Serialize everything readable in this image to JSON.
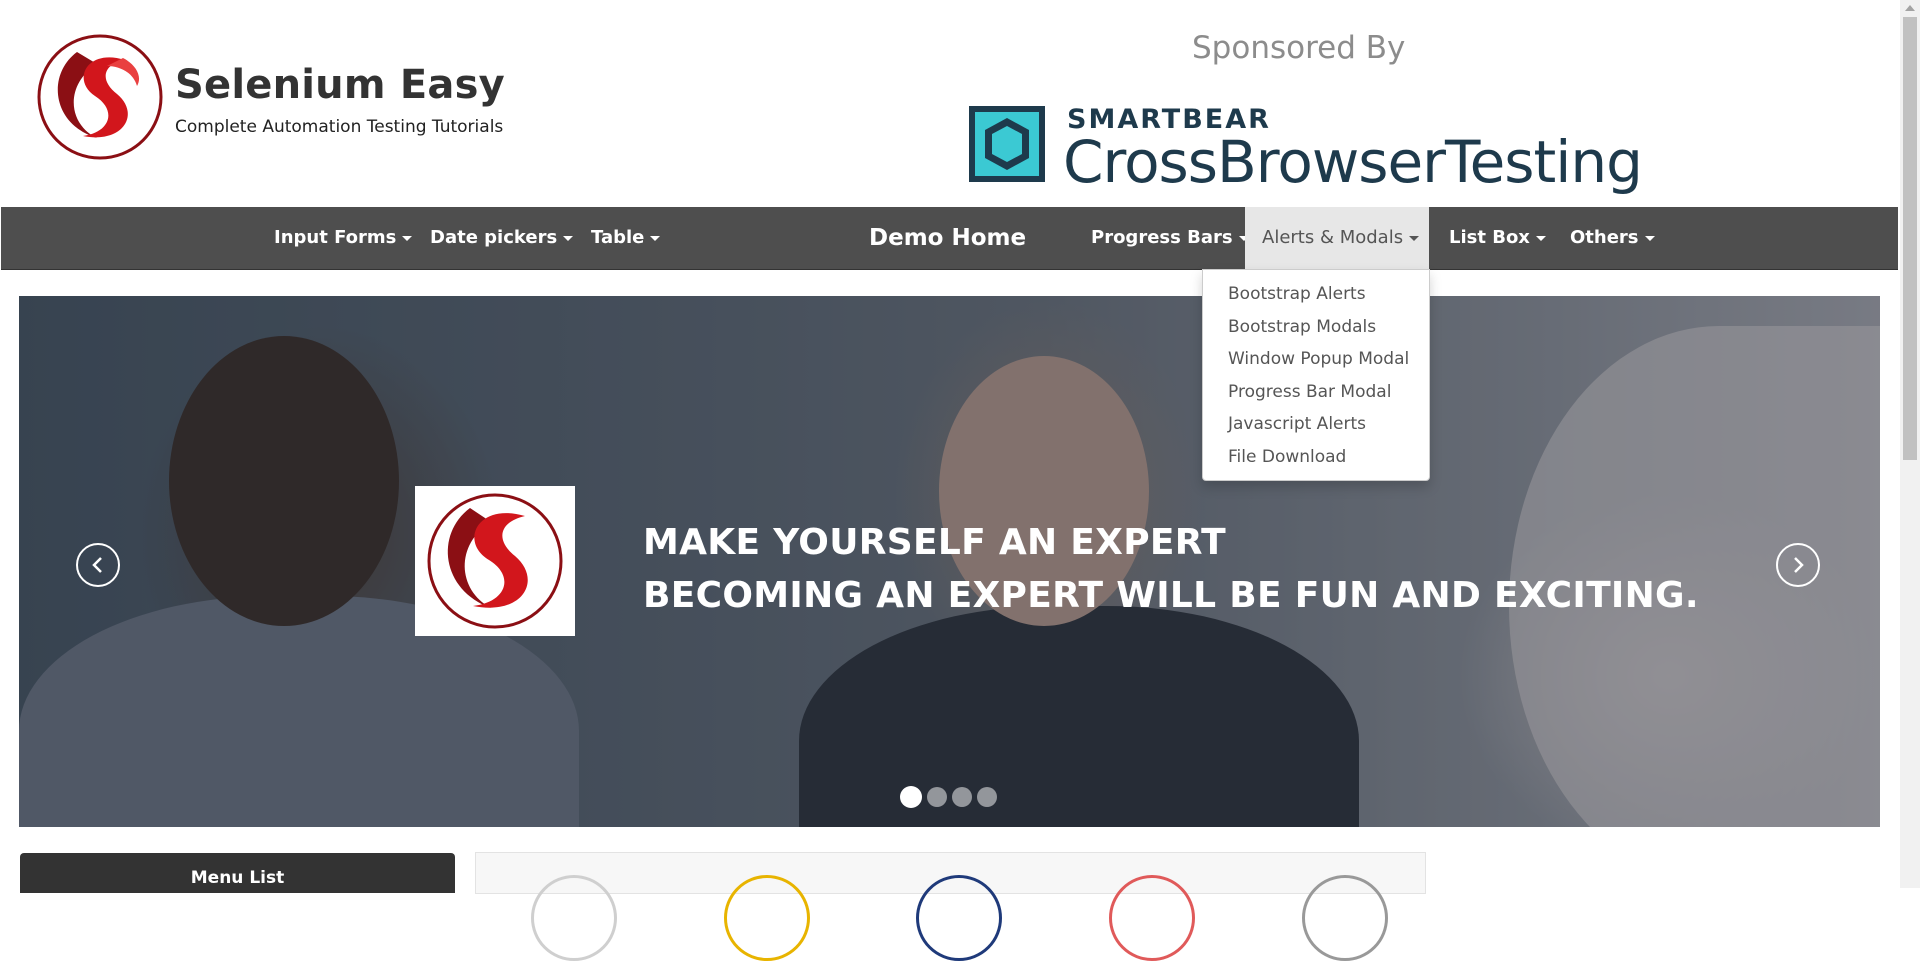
{
  "header": {
    "site_title": "Selenium Easy",
    "site_subtitle": "Complete Automation Testing Tutorials",
    "sponsor_label": "Sponsored By",
    "sponsor_brand": "SMARTBEAR",
    "sponsor_product": "CrossBrowserTesting"
  },
  "navbar": {
    "left_items": [
      {
        "label": "Input Forms"
      },
      {
        "label": "Date pickers"
      },
      {
        "label": "Table"
      }
    ],
    "center_label": "Demo Home",
    "right_items": [
      {
        "label": "Progress Bars"
      },
      {
        "label": "Alerts & Modals",
        "active": true
      },
      {
        "label": "List Box"
      },
      {
        "label": "Others"
      }
    ]
  },
  "dropdown": {
    "items": [
      "Bootstrap Alerts",
      "Bootstrap Modals",
      "Window Popup Modal",
      "Progress Bar Modal",
      "Javascript Alerts",
      "File Download"
    ]
  },
  "carousel": {
    "line1": "MAKE YOURSELF AN EXPERT",
    "line2": "BECOMING AN EXPERT WILL BE FUN AND EXCITING.",
    "slide_count": 4,
    "active_slide": 1
  },
  "sidebar": {
    "menu_title": "Menu List"
  },
  "colors": {
    "navbar": "#4e4e4e",
    "accent_red": "#c4161c",
    "sponsor_teal": "#3bc9d3",
    "sponsor_navy": "#1e3a4c"
  }
}
